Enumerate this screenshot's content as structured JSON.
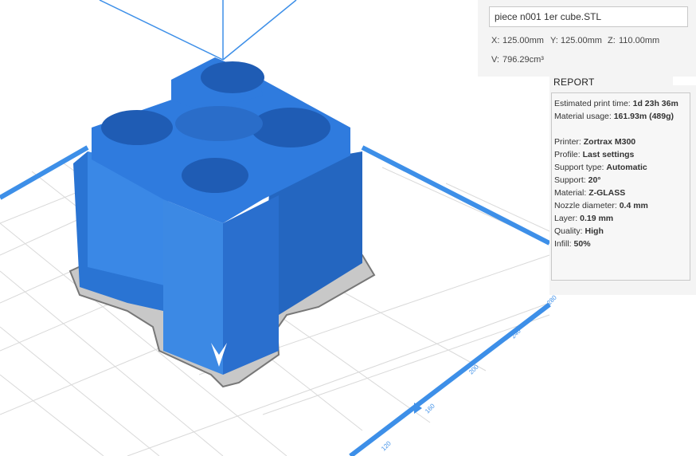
{
  "file": {
    "name": "piece n001 1er cube.STL"
  },
  "dimensions": {
    "x_label": "X:",
    "x": "125.00mm",
    "y_label": "Y:",
    "y": "125.00mm",
    "z_label": "Z:",
    "z": "110.00mm",
    "v_label": "V:",
    "v": "796.29cm³"
  },
  "report": {
    "title": "REPORT",
    "print_time_label": "Estimated print time:",
    "print_time": "1d 23h 36m",
    "material_usage_label": "Material usage:",
    "material_usage": "161.93m (489g)",
    "printer_label": "Printer:",
    "printer": "Zortrax M300",
    "profile_label": "Profile:",
    "profile": "Last settings",
    "support_type_label": "Support type:",
    "support_type": "Automatic",
    "support_label": "Support:",
    "support": "20°",
    "material_label": "Material:",
    "material": "Z-GLASS",
    "nozzle_label": "Nozzle diameter:",
    "nozzle": "0.4 mm",
    "layer_label": "Layer:",
    "layer": "0.19 mm",
    "quality_label": "Quality:",
    "quality": "High",
    "infill_label": "Infill:",
    "infill": "50%"
  },
  "ruler": {
    "ticks": [
      "120",
      "160",
      "200",
      "240",
      "280"
    ]
  },
  "colors": {
    "model": "#2f7bde",
    "platform_edge": "#3d8fe8",
    "grid": "#d9d9d9",
    "axis": "#3d8fe8"
  }
}
